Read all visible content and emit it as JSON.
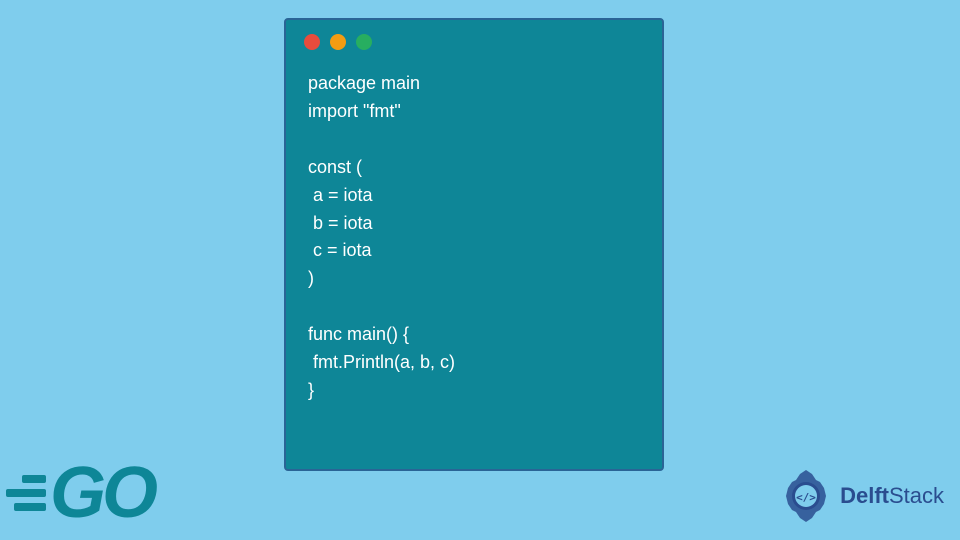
{
  "code": {
    "line1": "package main",
    "line2": "import \"fmt\"",
    "line3": "const (",
    "line4": " a = iota",
    "line5": " b = iota",
    "line6": " c = iota",
    "line7": ")",
    "line8": "func main() {",
    "line9": " fmt.Println(a, b, c)",
    "line10": "}"
  },
  "logos": {
    "go": "GO",
    "delft": "DelftStack",
    "delft_prefix": "Delft",
    "delft_suffix": "Stack"
  },
  "colors": {
    "background": "#7fcded",
    "window": "#0e8697",
    "border": "#2a6496",
    "text": "#ffffff",
    "logo_teal": "#0e8697",
    "delft_blue": "#2a4d8f"
  }
}
